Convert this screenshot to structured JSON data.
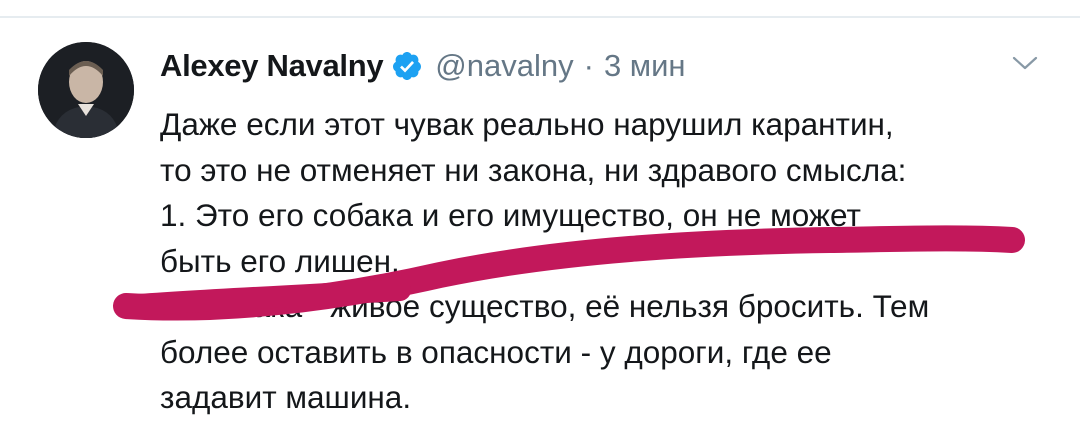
{
  "tweet": {
    "author_name": "Alexey Navalny",
    "handle": "@navalny",
    "separator": "·",
    "time": "3 мин",
    "avatar_icon": "avatar-photo",
    "verified_icon": "verified-badge-icon",
    "menu_icon": "chevron-down-icon",
    "text_lines": [
      "Даже если этот чувак реально нарушил карантин,",
      "то это не отменяет ни закона, ни здравого смысла:",
      "1. Это его собака и его имущество, он не может",
      "быть его лишен.",
      "2. Собака - живое существо, её нельзя бросить. Тем",
      "более оставить в опасности - у дороги, где ее",
      "задавит машина."
    ]
  },
  "colors": {
    "text": "#14171a",
    "secondary": "#657786",
    "verified": "#1da1f2",
    "scribble": "#c2185b"
  }
}
